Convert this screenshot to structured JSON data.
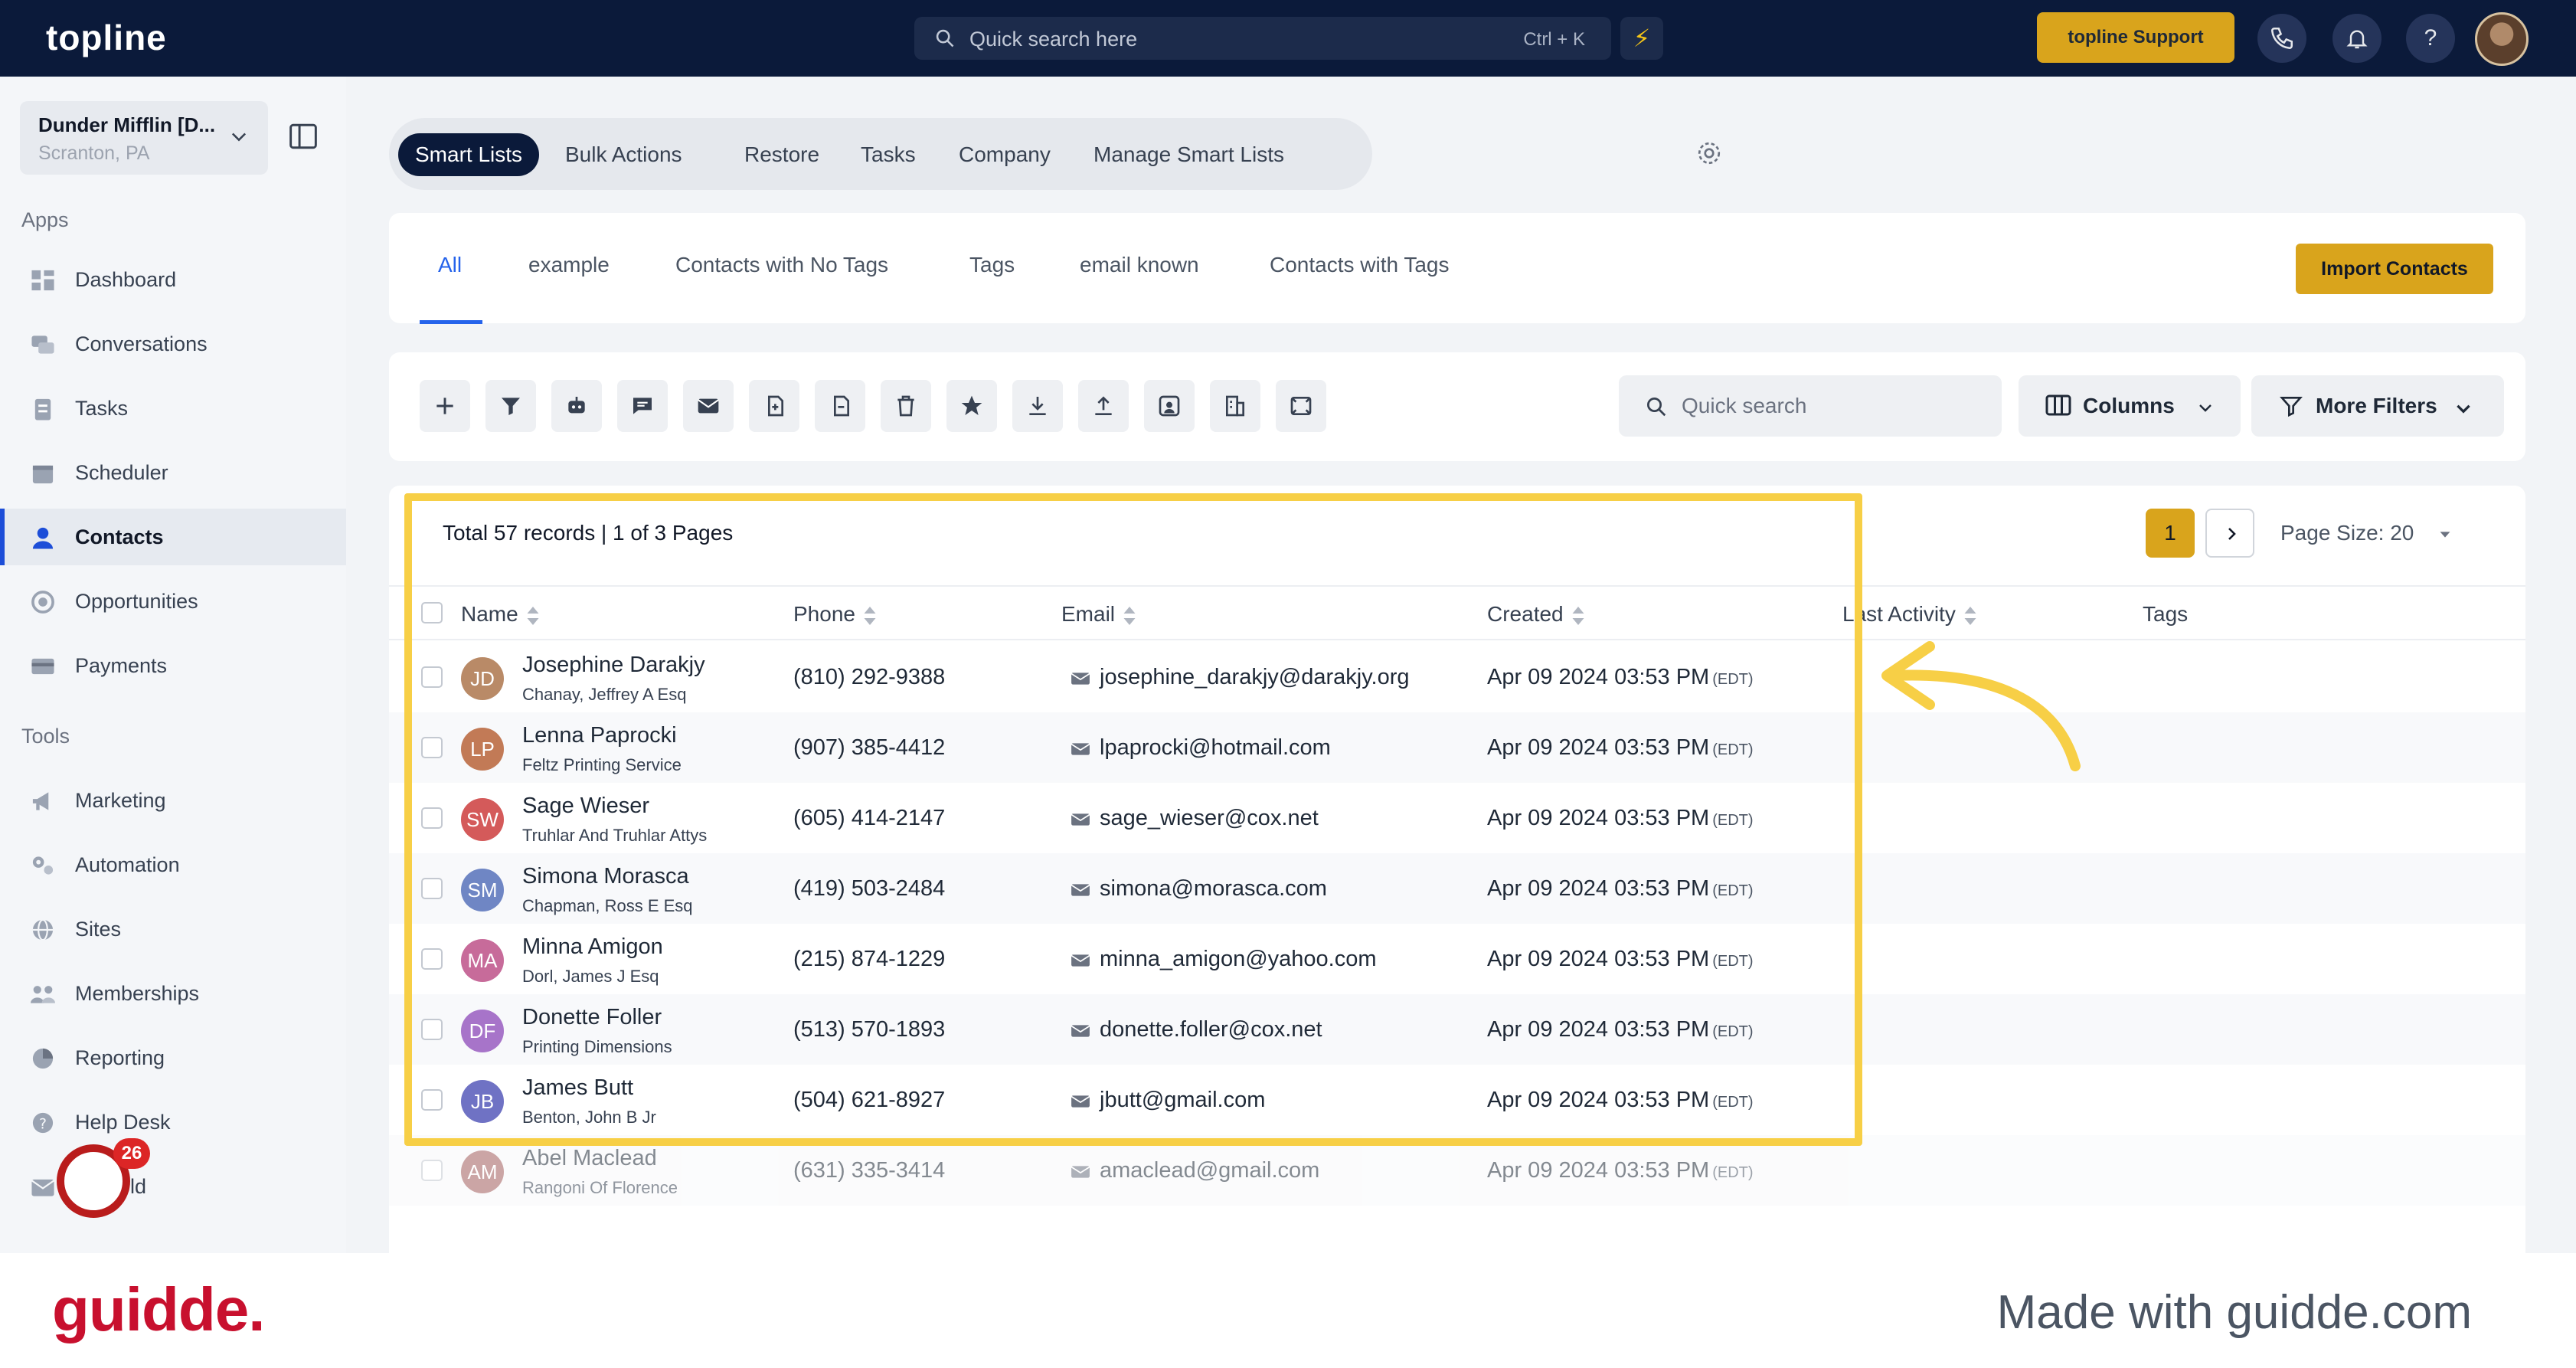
{
  "topbar": {
    "logo": "topline",
    "search_placeholder": "Quick search here",
    "search_shortcut": "Ctrl + K",
    "support_label": "topline Support"
  },
  "sidebar": {
    "account_name": "Dunder Mifflin [D...",
    "account_location": "Scranton, PA",
    "apps_label": "Apps",
    "tools_label": "Tools",
    "apps": [
      {
        "label": "Dashboard",
        "icon": "dashboard-icon"
      },
      {
        "label": "Conversations",
        "icon": "chat-icon"
      },
      {
        "label": "Tasks",
        "icon": "clipboard-icon"
      },
      {
        "label": "Scheduler",
        "icon": "calendar-icon"
      },
      {
        "label": "Contacts",
        "icon": "person-icon",
        "active": true
      },
      {
        "label": "Opportunities",
        "icon": "target-icon"
      },
      {
        "label": "Payments",
        "icon": "card-icon"
      }
    ],
    "tools": [
      {
        "label": "Marketing",
        "icon": "megaphone-icon"
      },
      {
        "label": "Automation",
        "icon": "cogs-icon"
      },
      {
        "label": "Sites",
        "icon": "globe-icon"
      },
      {
        "label": "Memberships",
        "icon": "people-icon"
      },
      {
        "label": "Reporting",
        "icon": "pie-icon"
      },
      {
        "label": "Help Desk",
        "icon": "help-icon"
      },
      {
        "label": "Mailfold",
        "icon": "mail-icon"
      }
    ],
    "chat_badge": "26"
  },
  "tabs_primary": [
    "Smart Lists",
    "Bulk Actions",
    "Restore",
    "Tasks",
    "Company",
    "Manage Smart Lists"
  ],
  "tabs_smartlists": [
    "All",
    "example",
    "Contacts with No Tags",
    "Tags",
    "email known",
    "Contacts with Tags"
  ],
  "import_label": "Import Contacts",
  "toolbar": {
    "quick_search_placeholder": "Quick search",
    "columns_label": "Columns",
    "more_filters_label": "More Filters"
  },
  "table": {
    "total_text": "Total 57 records | 1 of 3 Pages",
    "page_current": "1",
    "page_size_label": "Page Size: 20",
    "headers": [
      "Name",
      "Phone",
      "Email",
      "Created",
      "Last Activity",
      "Tags"
    ],
    "rows": [
      {
        "initials": "JD",
        "color": "#b98a67",
        "name": "Josephine Darakjy",
        "company": "Chanay, Jeffrey A Esq",
        "phone": "(810) 292-9388",
        "email": "josephine_darakjy@darakjy.org",
        "created": "Apr 09 2024 03:53 PM",
        "tz": "(EDT)"
      },
      {
        "initials": "LP",
        "color": "#c27a56",
        "name": "Lenna Paprocki",
        "company": "Feltz Printing Service",
        "phone": "(907) 385-4412",
        "email": "lpaprocki@hotmail.com",
        "created": "Apr 09 2024 03:53 PM",
        "tz": "(EDT)"
      },
      {
        "initials": "SW",
        "color": "#d45a5a",
        "name": "Sage Wieser",
        "company": "Truhlar And Truhlar Attys",
        "phone": "(605) 414-2147",
        "email": "sage_wieser@cox.net",
        "created": "Apr 09 2024 03:53 PM",
        "tz": "(EDT)"
      },
      {
        "initials": "SM",
        "color": "#6f86c4",
        "name": "Simona Morasca",
        "company": "Chapman, Ross E Esq",
        "phone": "(419) 503-2484",
        "email": "simona@morasca.com",
        "created": "Apr 09 2024 03:53 PM",
        "tz": "(EDT)"
      },
      {
        "initials": "MA",
        "color": "#c76b9a",
        "name": "Minna Amigon",
        "company": "Dorl, James J Esq",
        "phone": "(215) 874-1229",
        "email": "minna_amigon@yahoo.com",
        "created": "Apr 09 2024 03:53 PM",
        "tz": "(EDT)"
      },
      {
        "initials": "DF",
        "color": "#a774c9",
        "name": "Donette Foller",
        "company": "Printing Dimensions",
        "phone": "(513) 570-1893",
        "email": "donette.foller@cox.net",
        "created": "Apr 09 2024 03:53 PM",
        "tz": "(EDT)"
      },
      {
        "initials": "JB",
        "color": "#6f72c4",
        "name": "James Butt",
        "company": "Benton, John B Jr",
        "phone": "(504) 621-8927",
        "email": "jbutt@gmail.com",
        "created": "Apr 09 2024 03:53 PM",
        "tz": "(EDT)"
      },
      {
        "initials": "AM",
        "color": "#a25c5c",
        "name": "Abel Maclead",
        "company": "Rangoni Of Florence",
        "phone": "(631) 335-3414",
        "email": "amaclead@gmail.com",
        "created": "Apr 09 2024 03:53 PM",
        "tz": "(EDT)"
      }
    ]
  },
  "footer": {
    "brand": "guidde.",
    "made_with": "Made with guidde.com"
  },
  "colors": {
    "topbar": "#0b1a3a",
    "accent_gold": "#d9a41c",
    "highlight": "#f7cf46",
    "link_blue": "#2563eb",
    "guidde_red": "#c8102e"
  }
}
